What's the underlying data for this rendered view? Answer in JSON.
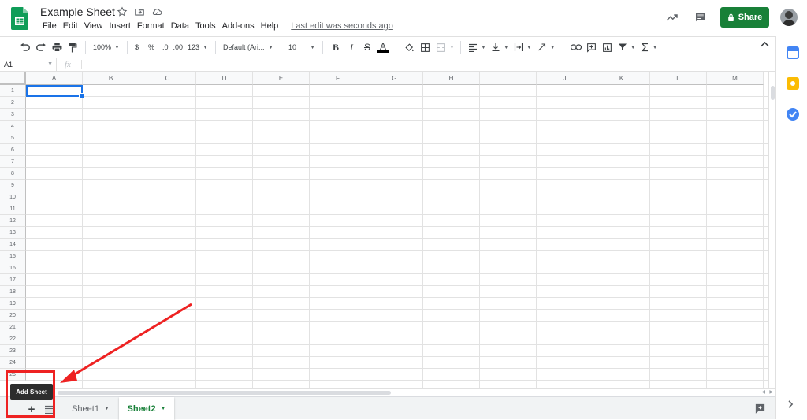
{
  "header": {
    "doc_title": "Example Sheet",
    "share_label": "Share",
    "menu": [
      "File",
      "Edit",
      "View",
      "Insert",
      "Format",
      "Data",
      "Tools",
      "Add-ons",
      "Help"
    ],
    "last_edit": "Last edit was seconds ago",
    "icons": [
      "sheets-logo-icon",
      "star-icon",
      "move-folder-icon",
      "cloud-saved-icon",
      "trending-icon",
      "comment-icon",
      "lock-icon",
      "avatar"
    ]
  },
  "toolbar": {
    "zoom": "100%",
    "currency": "$",
    "percent": "%",
    "dec_decrease": ".0",
    "dec_increase": ".00",
    "more_formats": "123",
    "font": "Default (Ari...",
    "font_size": "10",
    "bold": "B",
    "italic": "I",
    "strike": "S",
    "text_color": "A"
  },
  "formula_bar": {
    "cell_ref": "A1",
    "fx": "fx"
  },
  "grid": {
    "columns": [
      "A",
      "B",
      "C",
      "D",
      "E",
      "F",
      "G",
      "H",
      "I",
      "J",
      "K",
      "L",
      "M"
    ],
    "rows": [
      "1",
      "2",
      "3",
      "4",
      "5",
      "6",
      "7",
      "8",
      "9",
      "10",
      "11",
      "12",
      "13",
      "14",
      "15",
      "16",
      "17",
      "18",
      "19",
      "20",
      "21",
      "22",
      "23",
      "24",
      "25"
    ],
    "selected_cell": "A1"
  },
  "sheet_tabs": {
    "tabs": [
      {
        "label": "Sheet1",
        "active": false
      },
      {
        "label": "Sheet2",
        "active": true
      }
    ],
    "add_sheet_symbol": "+",
    "tooltip": "Add Sheet"
  },
  "colors": {
    "share_green": "#188038",
    "selection_blue": "#1a73e8",
    "annotation_red": "#e22222"
  }
}
